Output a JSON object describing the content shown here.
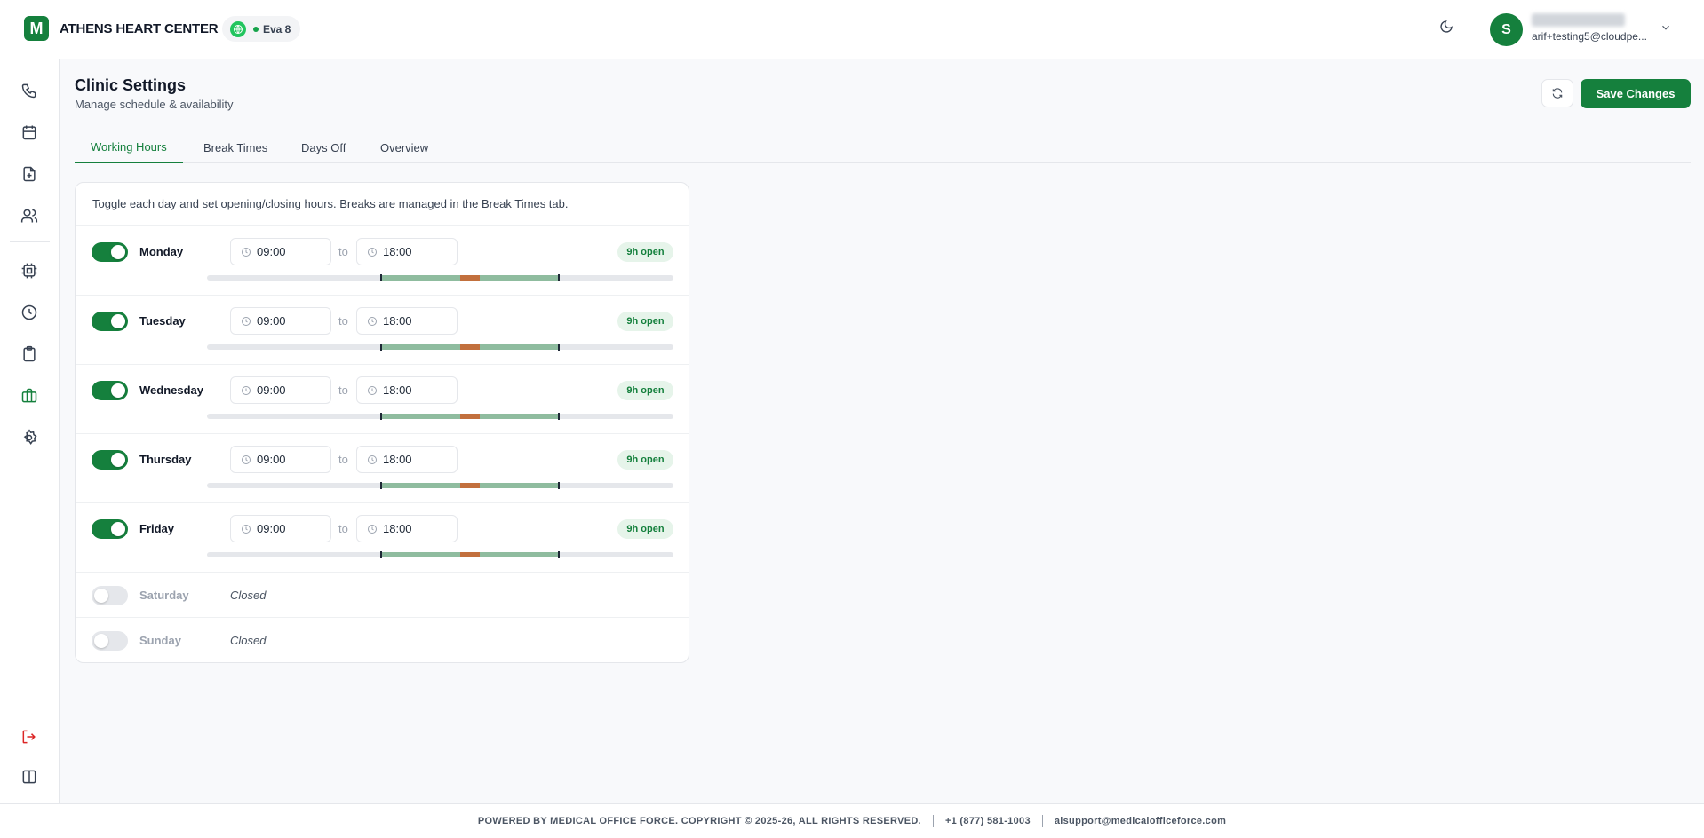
{
  "header": {
    "logo_letter": "M",
    "org_name": "ATHENS HEART CENTER",
    "agent_name": "Eva 8",
    "user_initial": "S",
    "user_email": "arif+testing5@cloudpe..."
  },
  "sidebar": {
    "items": [
      "phone-icon",
      "calendar-icon",
      "file-plus-icon",
      "users-icon",
      "cpu-icon",
      "clock-icon",
      "clipboard-icon",
      "briefcase-icon",
      "settings-icon",
      "logout-icon",
      "panel-icon"
    ],
    "active": "briefcase-icon"
  },
  "page": {
    "title": "Clinic Settings",
    "subtitle": "Manage schedule & availability",
    "save_label": "Save Changes"
  },
  "tabs": [
    "Working Hours",
    "Break Times",
    "Days Off",
    "Overview"
  ],
  "active_tab": "Working Hours",
  "hint": "Toggle each day and set opening/closing hours. Breaks are managed in the Break Times tab.",
  "to_label": "to",
  "days": [
    {
      "name": "Monday",
      "enabled": true,
      "open": "09:00",
      "close": "18:00",
      "badge": "9h open"
    },
    {
      "name": "Tuesday",
      "enabled": true,
      "open": "09:00",
      "close": "18:00",
      "badge": "9h open"
    },
    {
      "name": "Wednesday",
      "enabled": true,
      "open": "09:00",
      "close": "18:00",
      "badge": "9h open"
    },
    {
      "name": "Thursday",
      "enabled": true,
      "open": "09:00",
      "close": "18:00",
      "badge": "9h open"
    },
    {
      "name": "Friday",
      "enabled": true,
      "open": "09:00",
      "close": "18:00",
      "badge": "9h open"
    },
    {
      "name": "Saturday",
      "enabled": false,
      "status": "Closed"
    },
    {
      "name": "Sunday",
      "enabled": false,
      "status": "Closed"
    }
  ],
  "footer": {
    "copyright": "POWERED BY MEDICAL OFFICE FORCE. COPYRIGHT © 2025-26, ALL RIGHTS RESERVED.",
    "phone": "+1 (877) 581-1003",
    "email": "aisupport@medicalofficeforce.com"
  },
  "colors": {
    "accent": "#15803d",
    "open_segment": "#8fbc9f",
    "break_segment": "#c2703d"
  }
}
